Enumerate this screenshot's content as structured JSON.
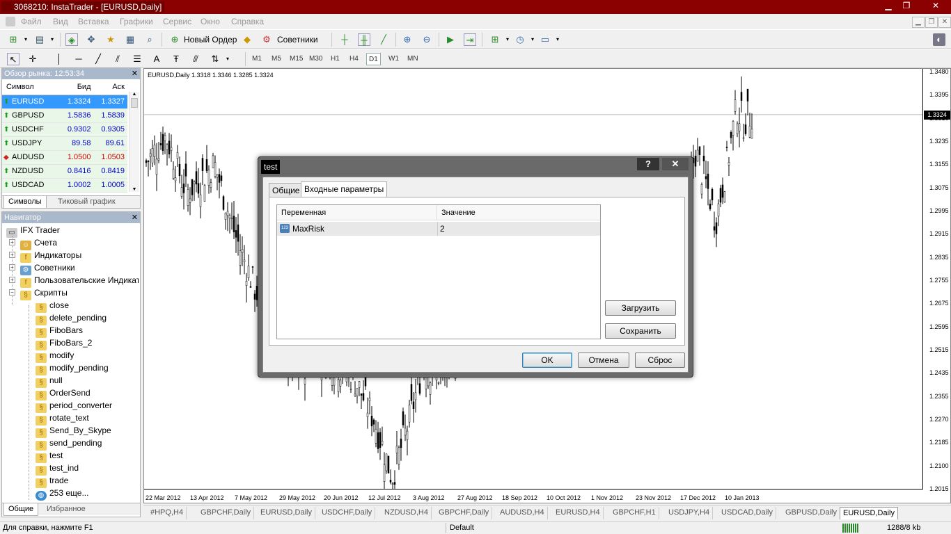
{
  "window": {
    "title": "3068210: InstaTrader - [EURUSD,Daily]",
    "min": "▁",
    "max": "❐",
    "close": "✕"
  },
  "menu": [
    "Файл",
    "Вид",
    "Вставка",
    "Графики",
    "Сервис",
    "Окно",
    "Справка"
  ],
  "toolbar1": {
    "new_order": "Новый Ордер",
    "advisors": "Советники"
  },
  "timeframes": [
    "M1",
    "M5",
    "M15",
    "M30",
    "H1",
    "H4",
    "D1",
    "W1",
    "MN"
  ],
  "active_timeframe": "D1",
  "market_watch": {
    "title": "Обзор рынка: 12:53:34",
    "columns": [
      "Символ",
      "Бид",
      "Аск"
    ],
    "rows": [
      {
        "symbol": "EURUSD",
        "bid": "1.3324",
        "ask": "1.3327",
        "dir": "up"
      },
      {
        "symbol": "GBPUSD",
        "bid": "1.5836",
        "ask": "1.5839",
        "dir": "up"
      },
      {
        "symbol": "USDCHF",
        "bid": "0.9302",
        "ask": "0.9305",
        "dir": "up"
      },
      {
        "symbol": "USDJPY",
        "bid": "89.58",
        "ask": "89.61",
        "dir": "up"
      },
      {
        "symbol": "AUDUSD",
        "bid": "1.0500",
        "ask": "1.0503",
        "dir": "down"
      },
      {
        "symbol": "NZDUSD",
        "bid": "0.8416",
        "ask": "0.8419",
        "dir": "up"
      },
      {
        "symbol": "USDCAD",
        "bid": "1.0002",
        "ask": "1.0005",
        "dir": "up"
      }
    ],
    "tabs": [
      "Символы",
      "Тиковый график"
    ]
  },
  "navigator": {
    "title": "Навигатор",
    "root": "IFX Trader",
    "folders": [
      "Счета",
      "Индикаторы",
      "Советники",
      "Пользовательские Индикато",
      "Скрипты"
    ],
    "scripts": [
      "close",
      "delete_pending",
      "FiboBars",
      "FiboBars_2",
      "modify",
      "modify_pending",
      "null",
      "OrderSend",
      "period_converter",
      "rotate_text",
      "Send_By_Skype",
      "send_pending",
      "test",
      "test_ind",
      "trade",
      "253 еще..."
    ],
    "tabs": [
      "Общие",
      "Избранное"
    ]
  },
  "chart": {
    "info": "EURUSD,Daily  1.3318 1.3346 1.3285 1.3324",
    "current_price": "1.3324",
    "y_labels": [
      "1.3480",
      "1.3395",
      "1.3310",
      "1.3235",
      "1.3155",
      "1.3075",
      "1.2995",
      "1.2915",
      "1.2835",
      "1.2755",
      "1.2675",
      "1.2595",
      "1.2515",
      "1.2435",
      "1.2355",
      "1.2270",
      "1.2185",
      "1.2100",
      "1.2015"
    ],
    "x_labels": [
      "22 Mar 2012",
      "13 Apr 2012",
      "7 May 2012",
      "29 May 2012",
      "20 Jun 2012",
      "12 Jul 2012",
      "3 Aug 2012",
      "27 Aug 2012",
      "18 Sep 2012",
      "10 Oct 2012",
      "1 Nov 2012",
      "23 Nov 2012",
      "17 Dec 2012",
      "10 Jan 2013"
    ]
  },
  "chart_tabs": [
    "#HPQ,H4",
    "GBPCHF,Daily",
    "EURUSD,Daily",
    "USDCHF,Daily",
    "NZDUSD,H4",
    "GBPCHF,Daily",
    "AUDUSD,H4",
    "EURUSD,H4",
    "GBPCHF,H1",
    "USDJPY,H4",
    "USDCAD,Daily",
    "GBPUSD,Daily",
    "EURUSD,Daily"
  ],
  "status": {
    "help": "Для справки, нажмите F1",
    "profile": "Default",
    "traffic": "1288/8 kb"
  },
  "dialog": {
    "title": "test",
    "help": "?",
    "close": "✕",
    "tabs": [
      "Общие",
      "Входные параметры"
    ],
    "columns": [
      "Переменная",
      "Значение"
    ],
    "params": [
      {
        "name": "MaxRisk",
        "value": "2",
        "type_icon": "123"
      }
    ],
    "load": "Загрузить",
    "save": "Сохранить",
    "ok": "OK",
    "cancel": "Отмена",
    "reset": "Сброс"
  }
}
